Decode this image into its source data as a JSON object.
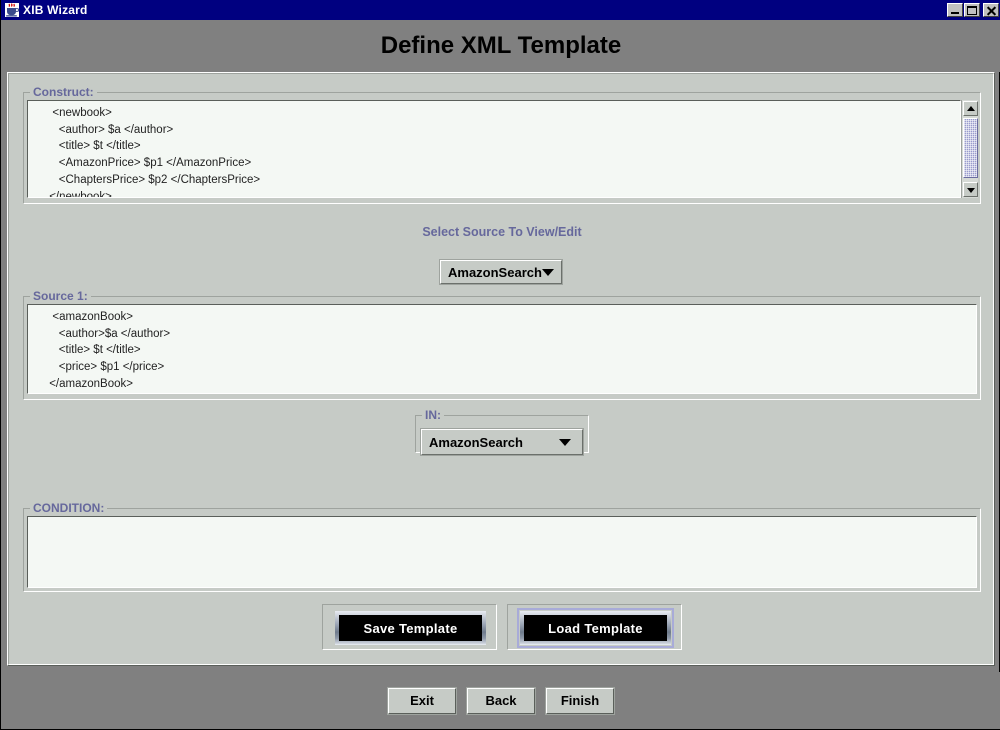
{
  "window": {
    "title": "XIB Wizard",
    "icon": "java-coffee-cup-icon",
    "controls": {
      "minimize": "minimize-icon",
      "maximize": "maximize-icon",
      "close": "close-icon"
    }
  },
  "header": {
    "title": "Define XML Template"
  },
  "construct": {
    "legend": "Construct:",
    "lines": [
      "  <newbook>",
      "    <author> $a </author>",
      "    <title> $t </title>",
      "    <AmazonPrice> $p1 </AmazonPrice>",
      "    <ChaptersPrice> $p2 </ChaptersPrice>",
      " </newbook>"
    ]
  },
  "select_source": {
    "label": "Select Source To View/Edit",
    "combo_value": "AmazonSearch",
    "combo_options": [
      "AmazonSearch"
    ]
  },
  "source": {
    "legend": "Source 1:",
    "lines": [
      "  <amazonBook>",
      "    <author>$a </author>",
      "    <title> $t </title>",
      "    <price> $p1 </price>",
      " </amazonBook>"
    ]
  },
  "in_group": {
    "legend": "IN:",
    "combo_value": "AmazonSearch",
    "combo_options": [
      "AmazonSearch"
    ]
  },
  "condition": {
    "legend": "CONDITION:",
    "value": ""
  },
  "template_actions": {
    "save_label": "Save Template",
    "load_label": "Load Template"
  },
  "footer": {
    "exit_label": "Exit",
    "back_label": "Back",
    "finish_label": "Finish"
  },
  "colors": {
    "titlebar": "#000080",
    "header_band": "#808080",
    "panel": "#c6cbc6",
    "legend_text": "#66689c",
    "textarea_bg": "#f4f8f4",
    "scrollbar_thumb": "#9a9ccd",
    "button_face": "#000000",
    "button_text": "#ffffff"
  }
}
